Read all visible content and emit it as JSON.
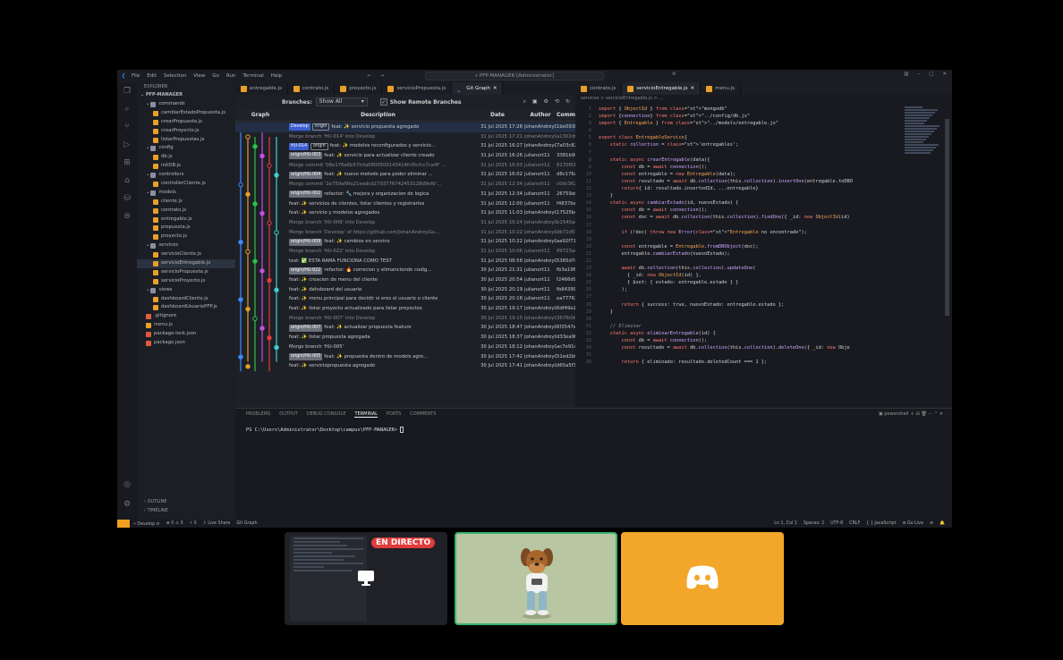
{
  "window": {
    "menus": [
      "File",
      "Edit",
      "Selection",
      "View",
      "Go",
      "Run",
      "Terminal",
      "Help"
    ],
    "command_center": "PFP-MANAGER [Administrator]"
  },
  "explorer": {
    "header": "EXPLORER",
    "root": "PFP-MANAGER",
    "items": [
      {
        "label": "commands",
        "type": "folder",
        "depth": 1
      },
      {
        "label": "cambiarEstadoPropuesta.js",
        "type": "js",
        "depth": 2
      },
      {
        "label": "crearPropuesta.js",
        "type": "js",
        "depth": 2
      },
      {
        "label": "crearProyecto.js",
        "type": "js",
        "depth": 2
      },
      {
        "label": "listarPropuestas.js",
        "type": "js",
        "depth": 2
      },
      {
        "label": "config",
        "type": "folder",
        "depth": 1
      },
      {
        "label": "db.js",
        "type": "js",
        "depth": 2
      },
      {
        "label": "initDB.js",
        "type": "js",
        "depth": 2
      },
      {
        "label": "controllers",
        "type": "folder",
        "depth": 1
      },
      {
        "label": "controllerCliente.js",
        "type": "js",
        "depth": 2
      },
      {
        "label": "models",
        "type": "folder",
        "depth": 1
      },
      {
        "label": "cliente.js",
        "type": "js",
        "depth": 2
      },
      {
        "label": "contrato.js",
        "type": "js",
        "depth": 2
      },
      {
        "label": "entregable.js",
        "type": "js",
        "depth": 2
      },
      {
        "label": "propuesta.js",
        "type": "js",
        "depth": 2
      },
      {
        "label": "proyecto.js",
        "type": "js",
        "depth": 2
      },
      {
        "label": "services",
        "type": "folder",
        "depth": 1
      },
      {
        "label": "servicioCliente.js",
        "type": "js",
        "depth": 2
      },
      {
        "label": "servicioEntregable.js",
        "type": "js",
        "depth": 2,
        "selected": true
      },
      {
        "label": "servicioPropuesta.js",
        "type": "js",
        "depth": 2
      },
      {
        "label": "servicioProyecto.js",
        "type": "js",
        "depth": 2
      },
      {
        "label": "views",
        "type": "folder",
        "depth": 1
      },
      {
        "label": "dashboardCliente.js",
        "type": "js",
        "depth": 2
      },
      {
        "label": "dashboardUsuarioPFP.js",
        "type": "js",
        "depth": 2
      },
      {
        "label": ".gitignore",
        "type": "git",
        "depth": 1
      },
      {
        "label": "menu.js",
        "type": "js",
        "depth": 1
      },
      {
        "label": "package-lock.json",
        "type": "json",
        "depth": 1
      },
      {
        "label": "package.json",
        "type": "json",
        "depth": 1
      }
    ],
    "outline": "OUTLINE",
    "timeline": "TIMELINE"
  },
  "tabs_left": [
    {
      "label": "entregable.js"
    },
    {
      "label": "contrato.js"
    },
    {
      "label": "proyecto.js"
    },
    {
      "label": "servicioPropuesta.js"
    },
    {
      "label": "Git Graph",
      "active": true
    }
  ],
  "tabs_right": [
    {
      "label": "contrato.js"
    },
    {
      "label": "servicioEntregable.js",
      "active": true
    },
    {
      "label": "menu.js"
    }
  ],
  "git_graph": {
    "branches_label": "Branches:",
    "branches_value": "Show All",
    "remote_label": "Show Remote Branches",
    "columns": [
      "Graph",
      "Description",
      "Date",
      "Author",
      "Commit"
    ],
    "rows": [
      {
        "tags": [
          {
            "t": "Develop",
            "k": "br"
          },
          {
            "t": "origin",
            "k": "dk"
          }
        ],
        "desc": "feat: ✨ servicio propuesta agregado",
        "date": "31 Jul 2025 17:26",
        "author": "JohanAndreyG...",
        "commit": "1be093b2",
        "cur": true
      },
      {
        "desc": "Merge branch 'HU-014' into Develop",
        "date": "31 Jul 2025 17:21",
        "author": "JohanAndreyG...",
        "commit": "a1302df2",
        "merge": true
      },
      {
        "tags": [
          {
            "t": "HU-014",
            "k": "br"
          },
          {
            "t": "origin",
            "k": "dk"
          }
        ],
        "desc": "feat: ✨ modelos reconfigurados y servicio...",
        "date": "31 Jul 2025 16:27",
        "author": "JohanAndreyG...",
        "commit": "7a03c82d"
      },
      {
        "tags": [
          {
            "t": "origin/HU-003",
            "k": "og"
          }
        ],
        "desc": "feat: ✨ servicio para actualizar cliente creado",
        "date": "31 Jul 2025 16:26",
        "author": "julianort11",
        "commit": "3381b9f8"
      },
      {
        "desc": "Merge commit '08e176a6b57fcfa0800500143414fcf0cfcc7ca4f' ...",
        "date": "31 Jul 2025 16:03",
        "author": "julianort11",
        "commit": "8170f012",
        "merge": true
      },
      {
        "tags": [
          {
            "t": "origin/HU-004",
            "k": "og"
          }
        ],
        "desc": "feat: ✨ nuevo metodo para poder eliminar ...",
        "date": "31 Jul 2025 16:02",
        "author": "julianort11",
        "commit": "d8c176a6"
      },
      {
        "desc": "Merge commit '2e759af9fa21eedcd2793776742453128d9efb'...",
        "date": "31 Jul 2025 12:34",
        "author": "julianort11",
        "commit": "c0dc3620",
        "merge": true
      },
      {
        "tags": [
          {
            "t": "origin/HU-002",
            "k": "og"
          }
        ],
        "desc": "refactor: 🔧 mejora y organizacion de logica",
        "date": "31 Jul 2025 12:34",
        "author": "julianort11",
        "commit": "26759af9"
      },
      {
        "desc": "feat: ✨ servicios de clientes, listar clientes y registrarlos",
        "date": "31 Jul 2025 12:00",
        "author": "julianort11",
        "commit": "f4837bac"
      },
      {
        "desc": "feat: ✨ servicio y modelos agregados",
        "date": "31 Jul 2025 11:03",
        "author": "JohanAndreyG...",
        "commit": "17525bc8"
      },
      {
        "desc": "Merge branch 'HU-009' into Develop",
        "date": "31 Jul 2025 10:24",
        "author": "JohanAndreyG...",
        "commit": "b1540a80",
        "merge": true
      },
      {
        "desc": "Merge branch 'Develop' of https://github.com/JohanAndreyGu...",
        "date": "31 Jul 2025 10:22",
        "author": "JohanAndreyG...",
        "commit": "db71d554",
        "merge": true
      },
      {
        "tags": [
          {
            "t": "origin/HU-009",
            "k": "og"
          }
        ],
        "desc": "feat: ✨ cambios en service",
        "date": "31 Jul 2025 10:22",
        "author": "JohanAndreyG...",
        "commit": "aa92f71f"
      },
      {
        "desc": "Merge branch 'HU-022' into Develop",
        "date": "31 Jul 2025 10:06",
        "author": "julianort11",
        "commit": "89723ae2",
        "merge": true
      },
      {
        "desc": "test: ✅ ESTA RAMA FUNCIONA COMO TEST",
        "date": "31 Jul 2025 08:58",
        "author": "JohanAndreyG...",
        "commit": "5365d7db"
      },
      {
        "tags": [
          {
            "t": "origin/HU-022",
            "k": "og"
          }
        ],
        "desc": "refactor: 🔥 correcion y elimancionde codig...",
        "date": "30 Jul 2025 21:31",
        "author": "julianort11",
        "commit": "fb3a196d"
      },
      {
        "desc": "feat: ✨ creacion de menu del cliente",
        "date": "30 Jul 2025 20:54",
        "author": "julianort11",
        "commit": "f2466d9e"
      },
      {
        "desc": "feat: ✨ dahsboard del usuario",
        "date": "30 Jul 2025 20:19",
        "author": "julianort11",
        "commit": "fb843994"
      },
      {
        "desc": "feat: ✨ menu principal para decidir si eres el usuario o cliente",
        "date": "30 Jul 2025 20:18",
        "author": "julianort11",
        "commit": "ea777623"
      },
      {
        "desc": "feat: ✨ listar proyecto actualizado para listar proyectos",
        "date": "30 Jul 2025 19:17",
        "author": "JohanAndreyG...",
        "commit": "6df49e28"
      },
      {
        "desc": "Merge branch 'HU-007' into Develop",
        "date": "30 Jul 2025 19:15",
        "author": "JohanAndreyG...",
        "commit": "367fb0b7",
        "merge": true
      },
      {
        "tags": [
          {
            "t": "origin/HU-007",
            "k": "og"
          }
        ],
        "desc": "feat: ✨ actualizar propuesta feature",
        "date": "30 Jul 2025 18:47",
        "author": "JohanAndreyG...",
        "commit": "6f3547ee"
      },
      {
        "desc": "feat: ✨ listar propuesta agregada",
        "date": "30 Jul 2025 18:37",
        "author": "JohanAndreyG...",
        "commit": "d33ea9f7"
      },
      {
        "desc": "Merge branch 'HU-005'",
        "date": "30 Jul 2025 18:12",
        "author": "JohanAndreyG...",
        "commit": "ac7e91ce"
      },
      {
        "tags": [
          {
            "t": "origin/HU-005",
            "k": "og"
          }
        ],
        "desc": "feat: ✨ propuesta dentro de models agre...",
        "date": "30 Jul 2025 17:42",
        "author": "JohanAndreyG...",
        "commit": "51ed2bfe"
      },
      {
        "desc": "feat: ✨ serviciopropuesta agregado",
        "date": "30 Jul 2025 17:41",
        "author": "JohanAndreyG...",
        "commit": "d65a5f39"
      }
    ]
  },
  "editor": {
    "breadcrumb": "services > servicioEntregable.js > ...",
    "lines": [
      "import { ObjectId } from \"mongodb\"",
      "import {connection} from \"../config/db.js\"",
      "import { Entregable } from \"../models/entregable.js\"",
      "",
      "export class EntregableService{",
      "    static collection = 'entregables';",
      "",
      "    static async crearEntregable(data){",
      "        const db = await connection();",
      "        const entregable = new Entregable(data);",
      "        const resultado = await db.collection(this.collection).insertOne(entregable.toDBO",
      "        return{ id: resultado.insertedId, ...entregable}",
      "    }",
      "    static async cambiarEstado(id, nuevoEstado) {",
      "        const db = await connection();",
      "        const doc = await db.collection(this.collection).findOne({ _id: new ObjectId(id)",
      "",
      "        if (!doc) throw new Error(\"Entregable no encontrado\");",
      "",
      "        const entregable = Entregable.fromDBObject(doc);",
      "        entregable.cambiarEstado(nuevoEstado);",
      "",
      "        await db.collection(this.collection).updateOne(",
      "          { _id: new ObjectId(id) },",
      "          { $set: { estado: entregable.estado } }",
      "        );",
      "",
      "        return { success: true, nuevoEstado: entregable.estado };",
      "    }",
      "",
      "    // Eliminar",
      "    static async eliminarEntregable(id) {",
      "        const db = await connection();",
      "        const resultado = await db.collection(this.collection).deleteOne({ _id: new Obje",
      "",
      "        return { eliminado: resultado.deletedCount === 1 };"
    ]
  },
  "panel": {
    "tabs": [
      "PROBLEMS",
      "OUTPUT",
      "DEBUG CONSOLE",
      "TERMINAL",
      "PORTS",
      "COMMENTS"
    ],
    "active_tab": "TERMINAL",
    "shell": "powershell",
    "prompt": "PS C:\\Users\\Administrator\\Desktop\\campus\\PFP-MANAGER> "
  },
  "statusbar": {
    "branch": "Develop",
    "problems": "⊗ 0 ⚠ 0",
    "ports": "⚡ 0",
    "liveshare": "Live Share",
    "gitgraph": "Git Graph",
    "position": "Ln 1, Col 1",
    "spaces": "Spaces: 2",
    "encoding": "UTF-8",
    "eol": "CRLF",
    "language": "{ } JavaScript",
    "golive": "Go Live"
  },
  "tiles": {
    "live_label": "EN DIRECTO"
  },
  "colors": {
    "discord": "#f2a72a",
    "speaking_border": "#3bb46f",
    "live": "#e23b3b"
  }
}
